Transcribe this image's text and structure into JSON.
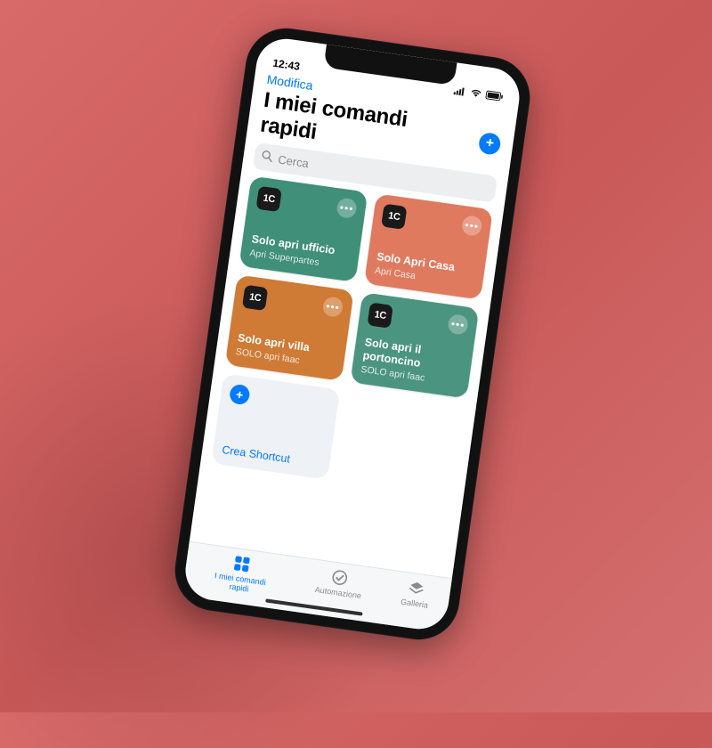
{
  "statusbar": {
    "time": "12:43"
  },
  "nav": {
    "edit": "Modifica"
  },
  "title": "I miei comandi rapidi",
  "search": {
    "placeholder": "Cerca"
  },
  "shortcuts": [
    {
      "title": "Solo apri ufficio",
      "subtitle": "Apri Superpartes",
      "badge": "1C",
      "color": "green1"
    },
    {
      "title": "Solo Apri Casa",
      "subtitle": "Apri Casa",
      "badge": "1C",
      "color": "coral"
    },
    {
      "title": "Solo apri villa",
      "subtitle": "SOLO apri faac",
      "badge": "1C",
      "color": "orange"
    },
    {
      "title": "Solo apri il portoncino",
      "subtitle": "SOLO apri faac",
      "badge": "1C",
      "color": "green2"
    }
  ],
  "create": {
    "label": "Crea Shortcut"
  },
  "tabs": {
    "shortcuts": "I miei comandi rapidi",
    "automation": "Automazione",
    "gallery": "Galleria"
  }
}
